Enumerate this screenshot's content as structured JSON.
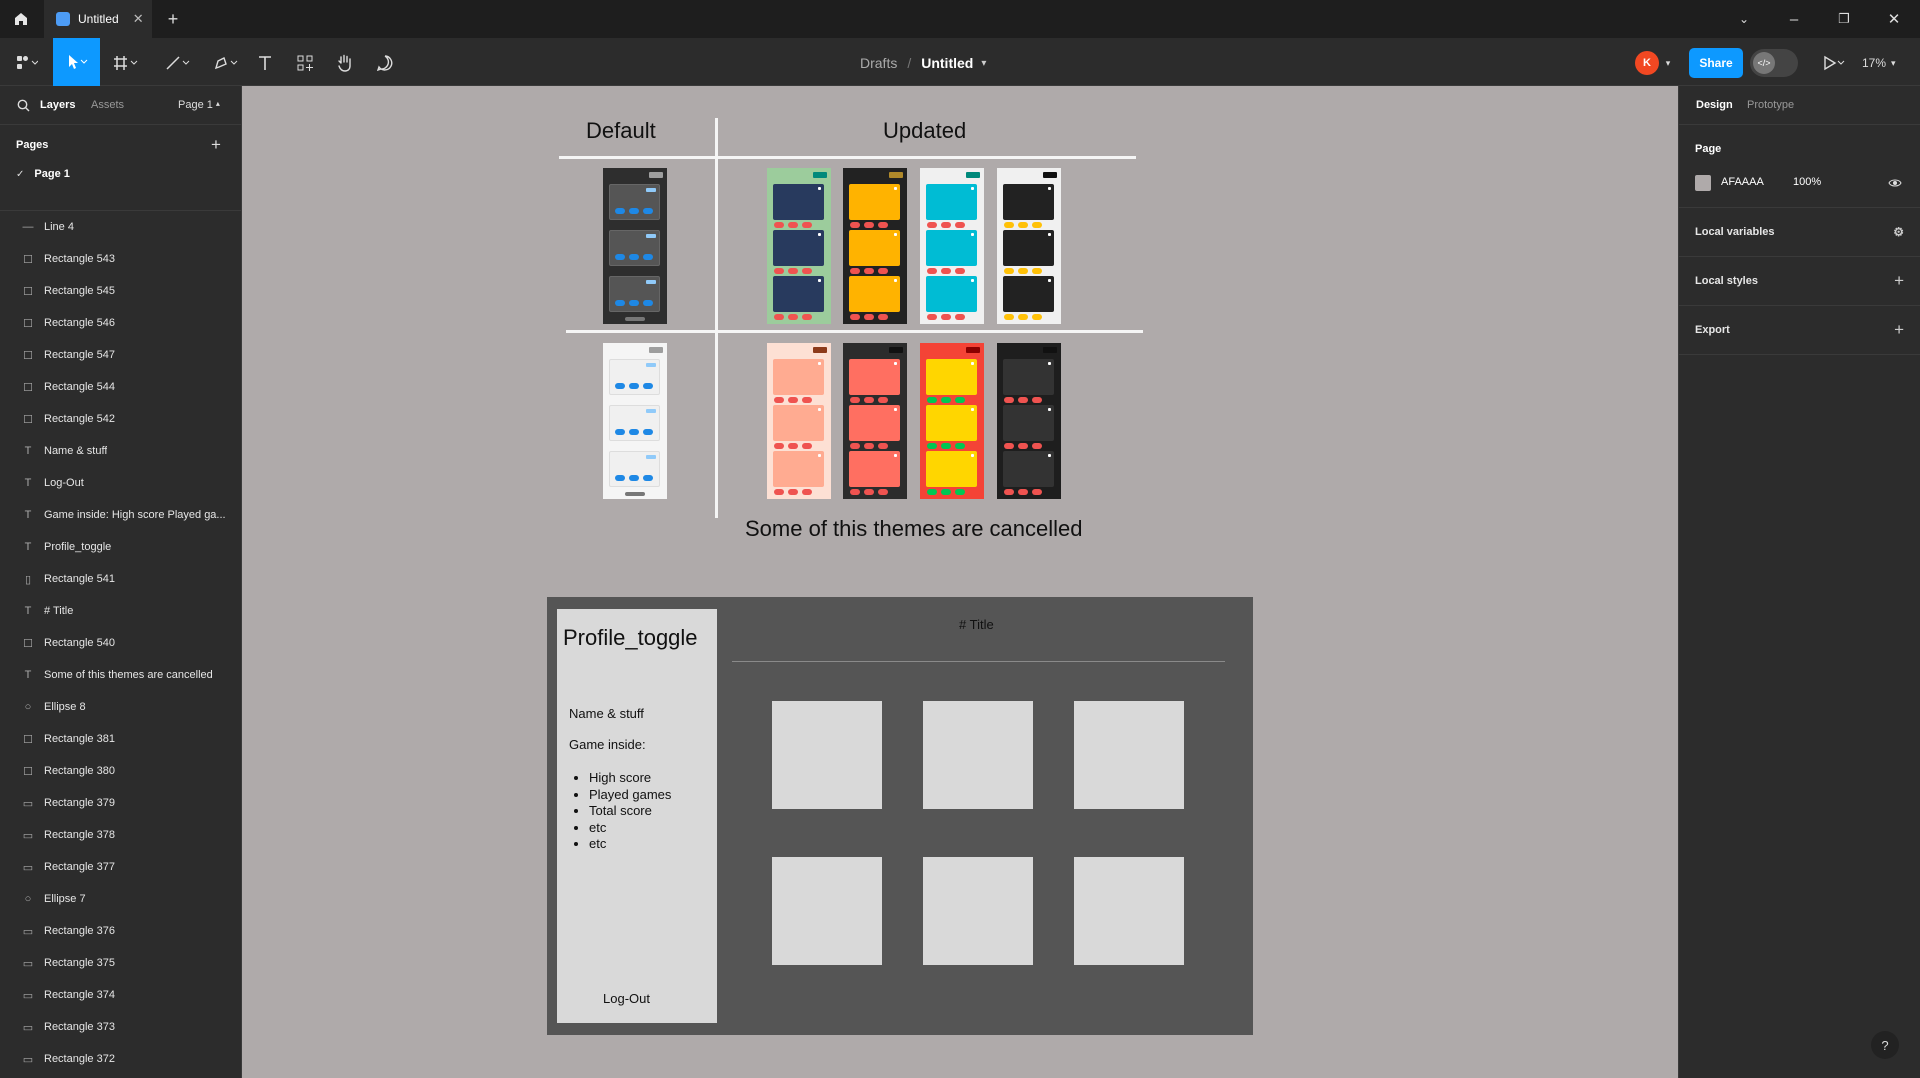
{
  "tabbar": {
    "tab_title": "Untitled"
  },
  "toolbar": {
    "breadcrumb_parent": "Drafts",
    "breadcrumb_sep": "/",
    "file_name": "Untitled",
    "share_label": "Share",
    "avatar_initial": "K",
    "zoom": "17%"
  },
  "left_panel": {
    "tab_layers": "Layers",
    "tab_assets": "Assets",
    "page_selector": "Page 1",
    "pages_header": "Pages",
    "current_page": "Page 1",
    "layers": [
      {
        "icon": "line",
        "name": "Line 4"
      },
      {
        "icon": "rect",
        "name": "Rectangle 543"
      },
      {
        "icon": "rect",
        "name": "Rectangle 545"
      },
      {
        "icon": "rect",
        "name": "Rectangle 546"
      },
      {
        "icon": "rect",
        "name": "Rectangle 547"
      },
      {
        "icon": "rect",
        "name": "Rectangle 544"
      },
      {
        "icon": "rect",
        "name": "Rectangle 542"
      },
      {
        "icon": "text",
        "name": "Name & stuff"
      },
      {
        "icon": "text",
        "name": "Log-Out"
      },
      {
        "icon": "text",
        "name": "Game inside: High score Played ga..."
      },
      {
        "icon": "text",
        "name": "Profile_toggle"
      },
      {
        "icon": "vrect",
        "name": "Rectangle 541"
      },
      {
        "icon": "text",
        "name": "# Title"
      },
      {
        "icon": "rect",
        "name": "Rectangle 540"
      },
      {
        "icon": "text",
        "name": "Some of this themes are cancelled"
      },
      {
        "icon": "ellipse",
        "name": "Ellipse 8"
      },
      {
        "icon": "rect",
        "name": "Rectangle 381"
      },
      {
        "icon": "rect",
        "name": "Rectangle 380"
      },
      {
        "icon": "pill",
        "name": "Rectangle 379"
      },
      {
        "icon": "pill",
        "name": "Rectangle 378"
      },
      {
        "icon": "pill",
        "name": "Rectangle 377"
      },
      {
        "icon": "ellipse",
        "name": "Ellipse 7"
      },
      {
        "icon": "pill",
        "name": "Rectangle 376"
      },
      {
        "icon": "pill",
        "name": "Rectangle 375"
      },
      {
        "icon": "pill",
        "name": "Rectangle 374"
      },
      {
        "icon": "pill",
        "name": "Rectangle 373"
      },
      {
        "icon": "pill",
        "name": "Rectangle 372"
      }
    ]
  },
  "right_panel": {
    "tab_design": "Design",
    "tab_prototype": "Prototype",
    "page_header": "Page",
    "page_color_hex": "AFAAAA",
    "page_color": "#afaaaa",
    "page_opacity": "100%",
    "local_variables": "Local variables",
    "local_styles": "Local styles",
    "export": "Export"
  },
  "canvas": {
    "header_default": "Default",
    "header_updated": "Updated",
    "caption": "Some of this themes are cancelled",
    "themes_top": [
      {
        "name": "default-dark",
        "bg": "#2e2e2e",
        "screen": "#555555",
        "dots": "#1e88e5",
        "corner": "#9e9e9e",
        "small": "#90caf9",
        "bar": "#777777"
      },
      {
        "name": "green-navy",
        "bg": "#9ccc9c",
        "screen": "#283a5e",
        "dots": "#ef5350",
        "corner": "#00897b",
        "small": "#ffffff",
        "bar": ""
      },
      {
        "name": "black-amber",
        "bg": "#222222",
        "screen": "#ffb300",
        "dots": "#ef5350",
        "corner": "#b0892a",
        "small": "#ffffff",
        "bar": ""
      },
      {
        "name": "white-cyan",
        "bg": "#f0f0f0",
        "screen": "#00bcd4",
        "dots": "#ef5350",
        "corner": "#00897b",
        "small": "#ffffff",
        "bar": ""
      },
      {
        "name": "white-black",
        "bg": "#f0f0f0",
        "screen": "#222222",
        "dots": "#ffc107",
        "corner": "#111111",
        "small": "#ffffff",
        "bar": ""
      }
    ],
    "themes_bottom": [
      {
        "name": "default-light",
        "bg": "#f5f5f5",
        "screen": "#f0f0f0",
        "dots": "#1e88e5",
        "corner": "#9e9e9e",
        "small": "#90caf9",
        "bar": "#777777"
      },
      {
        "name": "peach",
        "bg": "#fde0d4",
        "screen": "#ffab91",
        "dots": "#ef5350",
        "corner": "#8d3a1a",
        "small": "#ffffff",
        "bar": ""
      },
      {
        "name": "dark-salmon",
        "bg": "#2c2c2c",
        "screen": "#ff6f61",
        "dots": "#ef5350",
        "corner": "#111111",
        "small": "#ffffff",
        "bar": ""
      },
      {
        "name": "red-yellow",
        "bg": "#f44336",
        "screen": "#ffd600",
        "dots": "#00c853",
        "corner": "#8b0000",
        "small": "#ffffff",
        "bar": ""
      },
      {
        "name": "black-grey",
        "bg": "#1e1e1e",
        "screen": "#333333",
        "dots": "#ef5350",
        "corner": "#111111",
        "small": "#ffffff",
        "bar": ""
      }
    ],
    "mockup": {
      "profile_title": "Profile_toggle",
      "name_stuff": "Name & stuff",
      "game_inside": "Game inside:",
      "list": [
        "High score",
        "Played games",
        "Total score",
        "etc",
        "etc"
      ],
      "logout": "Log-Out",
      "title": "# Title"
    }
  }
}
